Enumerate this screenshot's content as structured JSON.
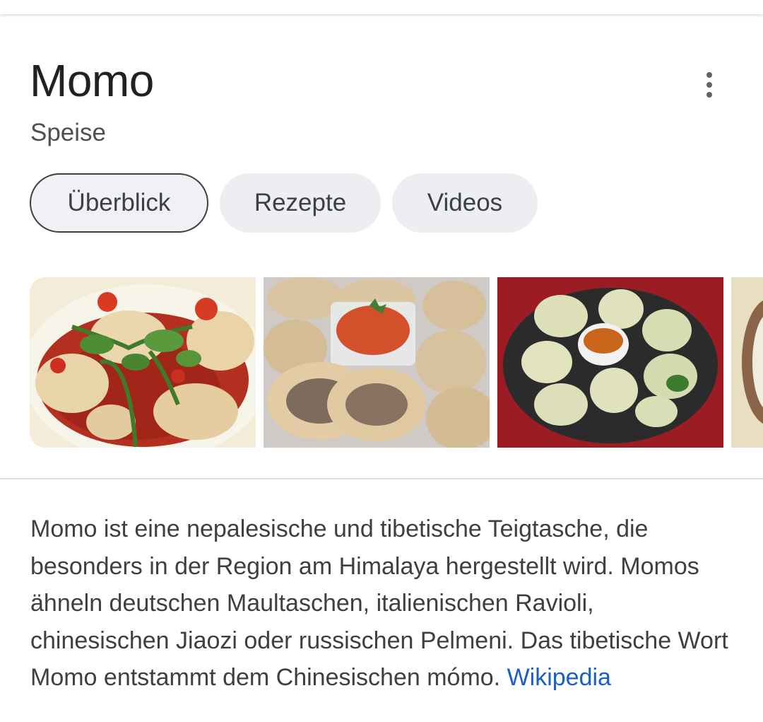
{
  "header": {
    "title": "Momo",
    "subtitle": "Speise",
    "more_icon": "more-vertical-icon"
  },
  "tabs": [
    {
      "label": "Überblick",
      "selected": true
    },
    {
      "label": "Rezepte",
      "selected": false
    },
    {
      "label": "Videos",
      "selected": false
    }
  ],
  "images": [
    {
      "subject": "momo-in-chili-sauce"
    },
    {
      "subject": "momo-cut-open-with-chutney"
    },
    {
      "subject": "momo-plate-on-red-cloth"
    },
    {
      "subject": "momo-in-steamer"
    }
  ],
  "description": {
    "text": "Momo ist eine nepalesische und tibetische Teigtasche, die besonders in der Region am Himalaya hergestellt wird. Momos ähneln deutschen Maultaschen, italienischen Ravioli, chinesischen Jiaozi oder russischen Pelmeni. Das tibetische Wort Momo entstammt dem Chinesischen mómo.",
    "source_link": "Wikipedia"
  },
  "colors": {
    "link": "#1a5fc8",
    "chip_bg": "#eceef1",
    "text": "#202124"
  }
}
